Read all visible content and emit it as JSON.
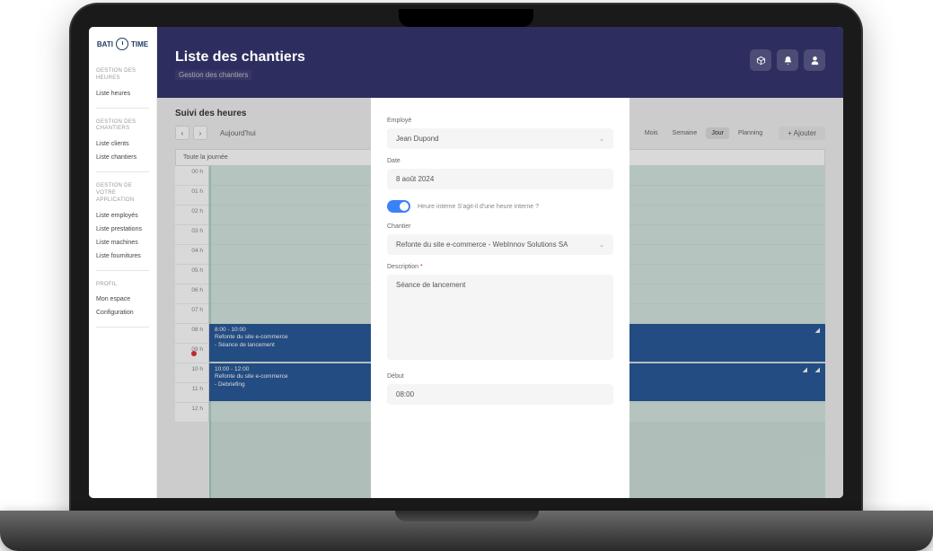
{
  "logo": {
    "left": "BATI",
    "right": "TIME"
  },
  "sidebar": {
    "groups": [
      {
        "title": "GESTION DES HEURES",
        "items": [
          "Liste heures"
        ]
      },
      {
        "title": "GESTION DES CHANTIERS",
        "items": [
          "Liste clients",
          "Liste chantiers"
        ]
      },
      {
        "title": "GESTION DE VOTRE APPLICATION",
        "items": [
          "Liste employés",
          "Liste prestations",
          "Liste machines",
          "Liste fournitures"
        ]
      },
      {
        "title": "PROFIL",
        "items": [
          "Mon espace",
          "Configuration"
        ]
      }
    ]
  },
  "header": {
    "title": "Liste des chantiers",
    "subtitle": "Gestion des chantiers"
  },
  "page": {
    "title": "Suivi des heures",
    "today": "Aujourd'hui",
    "add": "+  Ajouter"
  },
  "views": [
    "Mois",
    "Semaine",
    "Jour",
    "Planning"
  ],
  "active_view": "Jour",
  "calendar": {
    "all_day": "Toute la journée",
    "hours": [
      "00 h",
      "01 h",
      "02 h",
      "03 h",
      "04 h",
      "05 h",
      "06 h",
      "07 h",
      "08 h",
      "09 h",
      "10 h",
      "11 h",
      "12 h"
    ],
    "events": [
      {
        "time": "8:00 - 10:00",
        "title": "Refonte du site e-commerce",
        "desc": "- Séance de lancement"
      },
      {
        "time": "10:00 - 12:00",
        "title": "Refonte du site e-commerce",
        "desc": "- Debriefing"
      }
    ]
  },
  "modal": {
    "employee_label": "Employé",
    "employee_value": "Jean Dupond",
    "date_label": "Date",
    "date_value": "8 août 2024",
    "toggle_label": "Heure interne S'agit-il d'une heure interne ?",
    "chantier_label": "Chantier",
    "chantier_value": "Refonte du site e-commerce - WebInnov Solutions SA",
    "description_label": "Description",
    "description_value": "Séance de lancement",
    "start_label": "Début",
    "start_value": "08:00"
  },
  "colors": {
    "header_bg": "#2d2d5f",
    "event_bg": "#aed1c5",
    "event_blue": "#2a5a9a",
    "toggle": "#3b82f6"
  }
}
